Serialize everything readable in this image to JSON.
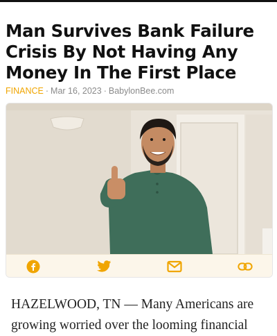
{
  "article": {
    "headline": "Man Survives Bank Failure Crisis By Not Having Any Money In The First Place",
    "category": "FINANCE",
    "date": "Mar 16, 2023",
    "source": "BabylonBee.com",
    "separator": "·",
    "body": "HAZELWOOD, TN — Many Americans are growing worried over the looming financial"
  },
  "share": {
    "items": [
      {
        "icon": "facebook-icon"
      },
      {
        "icon": "twitter-icon"
      },
      {
        "icon": "email-icon"
      },
      {
        "icon": "link-icon"
      }
    ]
  },
  "colors": {
    "category": "#f0a500",
    "share_icon": "#f0a500",
    "share_bar_bg": "#fcf6ea",
    "headline": "#111111",
    "meta": "#8a8a8a"
  }
}
